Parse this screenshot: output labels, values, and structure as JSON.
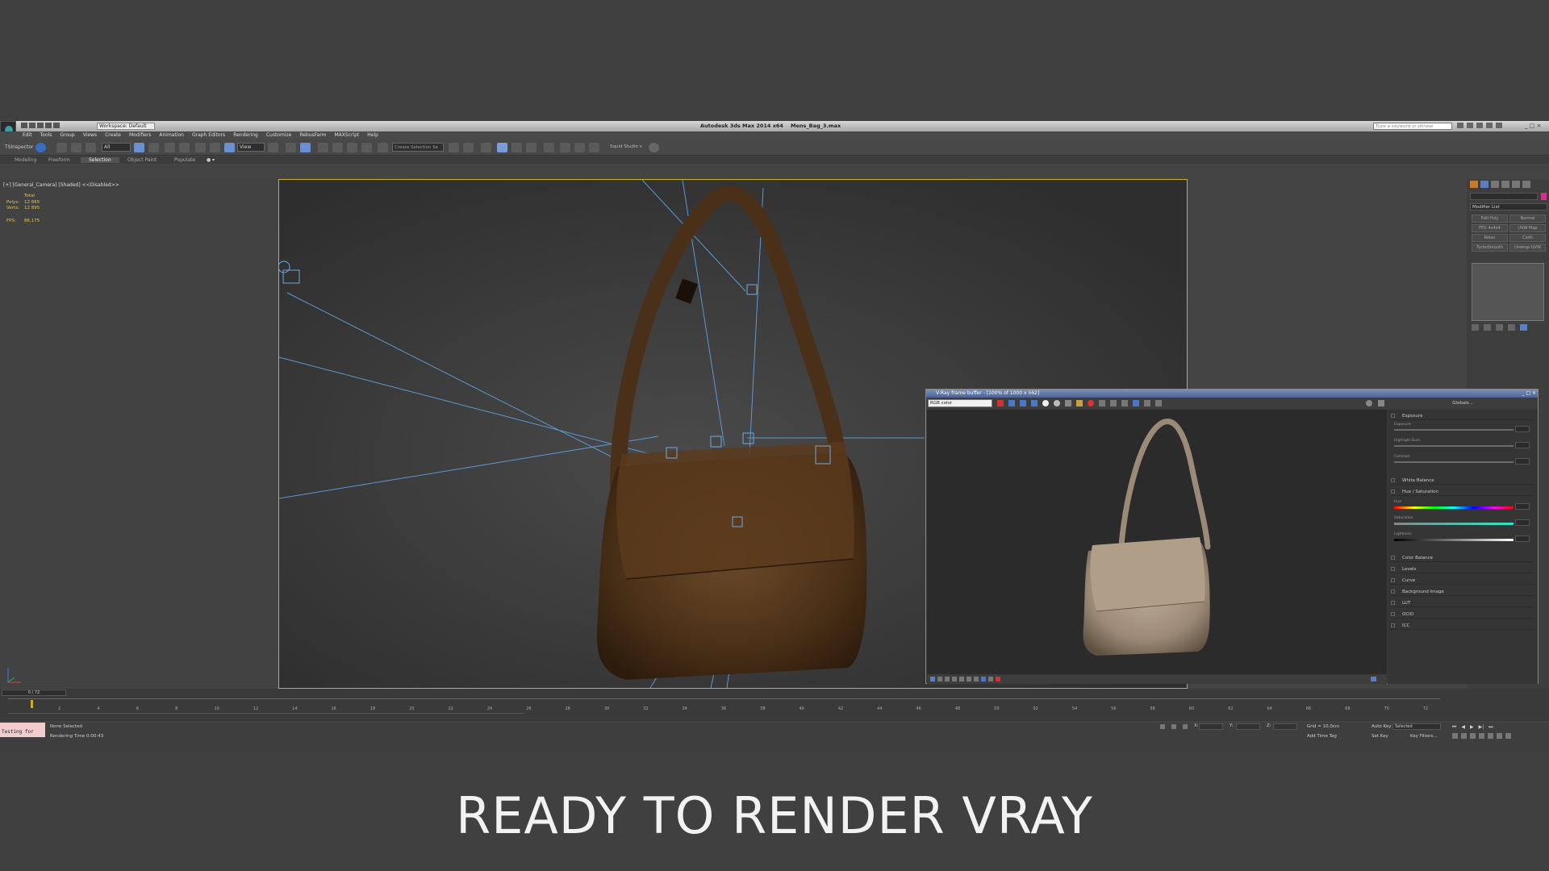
{
  "window": {
    "title": "Autodesk 3ds Max  2014 x64",
    "file": "Mens_Bag_3.max",
    "workspace": "Workspace: Default",
    "search_placeholder": "Type a keyword or phrase"
  },
  "menu": [
    "Edit",
    "Tools",
    "Group",
    "Views",
    "Create",
    "Modifiers",
    "Animation",
    "Graph Editors",
    "Rendering",
    "Customize",
    "RebusFarm",
    "MAXScript",
    "Help"
  ],
  "toolbar": {
    "inspector": "TSInspector",
    "filter_select": "All",
    "view_select": "View",
    "selection_set": "Create Selection Se",
    "squid": "Squid Studio v"
  },
  "ribbon_tabs": [
    "Modeling",
    "Freeform",
    "Selection",
    "Object Paint",
    "Populate"
  ],
  "viewport": {
    "label": "[+] [General_Camera] [Shaded]  <<Disabled>>",
    "stats_header": "Total",
    "polys_label": "Polys:",
    "polys_value": "12 865",
    "verts_label": "Verts:",
    "verts_value": "12 895",
    "fps_label": "FPS:",
    "fps_value": "86,175"
  },
  "command_panel": {
    "modifier_list": "Modifier List",
    "buttons": [
      "Edit Poly",
      "Normal",
      "FFD 4x4x4",
      "UVW Map",
      "Relax",
      "Cloth",
      "TurboSmooth",
      "Unwrap UVW"
    ]
  },
  "vfb": {
    "title": "V-Ray frame buffer - [100% of 1000 x 562]",
    "channel": "RGB color",
    "globals": "Globals...",
    "rows": [
      {
        "label": "Exposure"
      },
      {
        "label": "White Balance"
      },
      {
        "label": "Hue / Saturation"
      },
      {
        "label": "Color Balance"
      },
      {
        "label": "Levels"
      },
      {
        "label": "Curve"
      },
      {
        "label": "Background Image"
      },
      {
        "label": "LUT"
      },
      {
        "label": "OCIO"
      },
      {
        "label": "ICC"
      }
    ],
    "sliders": [
      "Exposure",
      "Highlight Burn",
      "Contrast",
      "Hue",
      "Saturation",
      "Lightness"
    ]
  },
  "timeline": {
    "frame": "0 / 72",
    "ticks": [
      "2",
      "4",
      "6",
      "8",
      "10",
      "12",
      "14",
      "16",
      "18",
      "20",
      "22",
      "24",
      "26",
      "28",
      "30",
      "32",
      "34",
      "36",
      "38",
      "40",
      "42",
      "44",
      "46",
      "48",
      "50",
      "52",
      "54",
      "56",
      "58",
      "60",
      "62",
      "64",
      "66",
      "68",
      "70",
      "72"
    ]
  },
  "status": {
    "testing": "Testing for",
    "selection": "None Selected",
    "render_time": "Rendering Time  0:00:43",
    "grid": "Grid = 10,0cm",
    "add_time_tag": "Add Time Tag",
    "auto_key": "Auto Key",
    "selected": "Selected",
    "set_key": "Set Key",
    "key_filters": "Key Filters...",
    "x_label": "X:",
    "y_label": "Y:",
    "z_label": "Z:"
  },
  "caption": "READY TO RENDER VRAY"
}
